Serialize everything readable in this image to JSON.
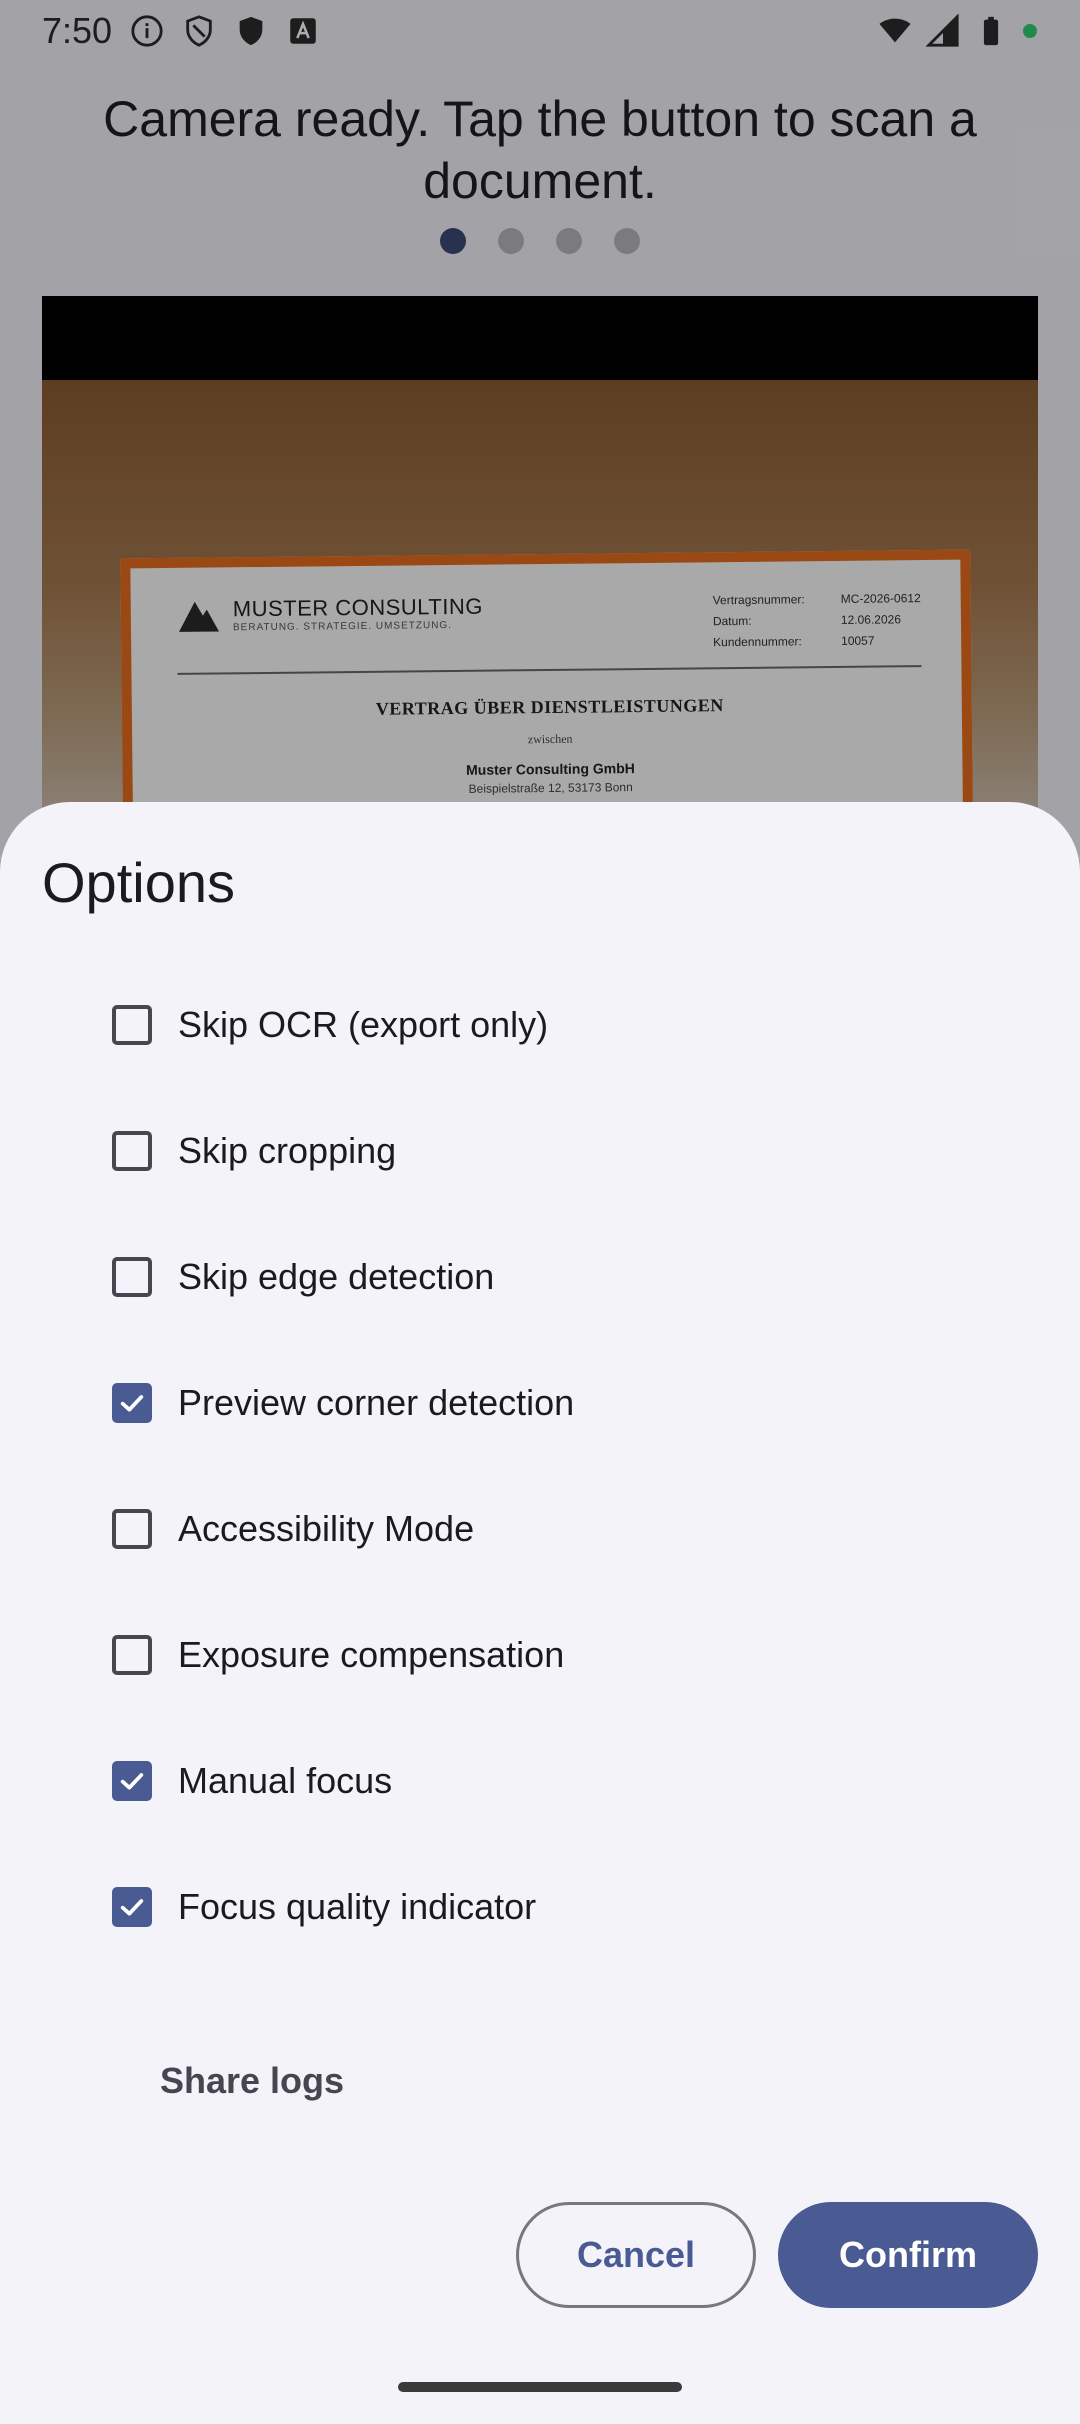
{
  "status_bar": {
    "time": "7:50",
    "left_icons": [
      "info-icon",
      "shield-outline-icon",
      "shield-filled-icon",
      "font-icon"
    ],
    "right_icons": [
      "wifi-icon",
      "cellular-icon",
      "battery-icon",
      "privacy-dot-icon"
    ],
    "privacy_dot_color": "#2ecc71"
  },
  "camera_screen": {
    "prompt": "Camera ready. Tap the button to scan a document.",
    "page_dots": 4,
    "active_dot": 0,
    "document": {
      "company": "MUSTER CONSULTING",
      "tagline": "BERATUNG. STRATEGIE. UMSETZUNG.",
      "meta": [
        {
          "label": "Vertragsnummer:",
          "value": "MC-2026-0612"
        },
        {
          "label": "Datum:",
          "value": "12.06.2026"
        },
        {
          "label": "Kundennummer:",
          "value": "10057"
        }
      ],
      "title": "VERTRAG ÜBER DIENSTLEISTUNGEN",
      "between": "zwischen",
      "party": "Muster Consulting GmbH",
      "address": "Beispielstraße 12, 53173 Bonn"
    }
  },
  "options_sheet": {
    "title": "Options",
    "options": [
      {
        "label": "Skip OCR (export only)",
        "checked": false
      },
      {
        "label": "Skip cropping",
        "checked": false
      },
      {
        "label": "Skip edge detection",
        "checked": false
      },
      {
        "label": "Preview corner detection",
        "checked": true
      },
      {
        "label": "Accessibility Mode",
        "checked": false
      },
      {
        "label": "Exposure compensation",
        "checked": false
      },
      {
        "label": "Manual focus",
        "checked": true
      },
      {
        "label": "Focus quality indicator",
        "checked": true
      }
    ],
    "share_logs": "Share logs",
    "cancel": "Cancel",
    "confirm": "Confirm",
    "accent_color": "#4a5b93"
  }
}
